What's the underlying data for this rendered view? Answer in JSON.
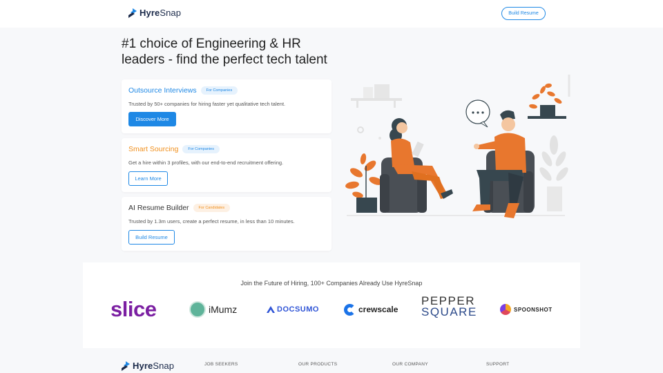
{
  "header": {
    "brand_bold": "Hyre",
    "brand_light": "Snap",
    "cta_label": "Build Resume"
  },
  "hero": {
    "title": "#1 choice of Engineering & HR leaders - find the perfect tech talent"
  },
  "cards": [
    {
      "title": "Outsource Interviews",
      "title_color": "#1e88e5",
      "badge": "For Companies",
      "description": "Trusted by 50+ companies for hiring faster yet qualitative tech talent.",
      "button": "Discover More"
    },
    {
      "title": "Smart Sourcing",
      "title_color": "#f0901e",
      "badge": "For Companies",
      "description": "Get a hire within 3 profiles, with our end-to-end recruitment offering.",
      "button": "Learn More"
    },
    {
      "title": "AI Resume Builder",
      "title_color": "#333333",
      "badge": "For Candidates",
      "description": "Trusted by 1.3m users, create a perfect resume, in less than 10 minutes.",
      "button": "Build Resume"
    }
  ],
  "illustration": {
    "speech_bubble": "..."
  },
  "companies": {
    "heading": "Join the Future of Hiring, 100+ Companies Already Use HyreSnap",
    "logos": {
      "slice": "slice",
      "imumz": "iMumz",
      "docsumo": "DOCSUMO",
      "crewscale": "crewscale",
      "pepper_1": "PEPPER",
      "pepper_2": "SQUARE",
      "spoonshot": "SPOONSHOT"
    }
  },
  "footer": {
    "brand_bold": "Hyre",
    "brand_light": "Snap",
    "columns": [
      "JOB SEEKERS",
      "OUR PRODUCTS",
      "OUR COMPANY",
      "SUPPORT"
    ]
  },
  "colors": {
    "primary": "#1e88e5",
    "accent_orange": "#f0901e",
    "brand_dark": "#1b2a4a"
  }
}
